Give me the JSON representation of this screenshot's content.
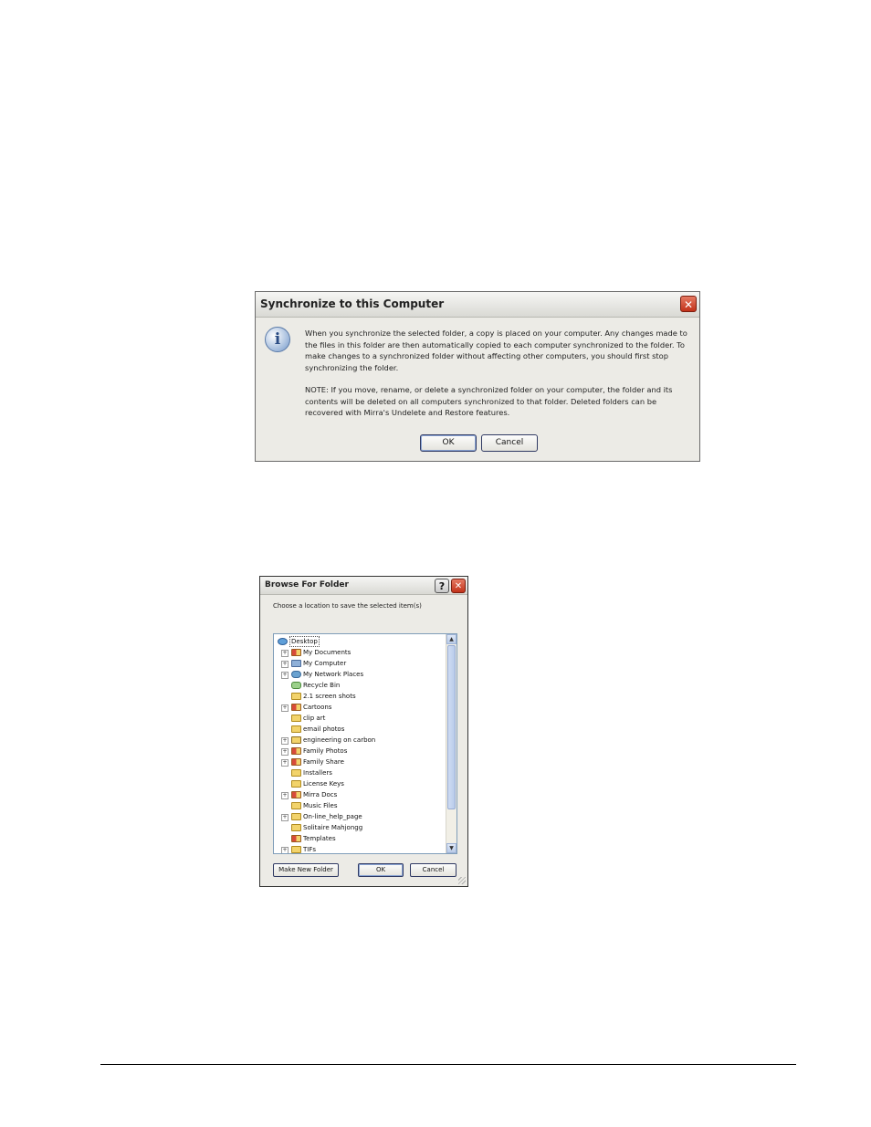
{
  "sync_dialog": {
    "title": "Synchronize to this Computer",
    "close_glyph": "✕",
    "info_icon_glyph": "i",
    "message_1": "When you synchronize the selected folder, a copy is placed on your computer. Any changes made to the files in this folder are then automatically copied to each computer synchronized to the folder.  To make changes to a synchronized folder without affecting other computers, you should first stop synchronizing the folder.",
    "message_2": "NOTE: If you move, rename, or delete a synchronized folder on your computer, the folder and its contents will be deleted on all computers synchronized to that folder.  Deleted folders can be recovered with Mirra's Undelete and Restore features.",
    "ok_label": "OK",
    "cancel_label": "Cancel"
  },
  "browse_dialog": {
    "title": "Browse For Folder",
    "help_glyph": "?",
    "close_glyph": "✕",
    "prompt": "Choose a location to save the selected item(s)",
    "tree": [
      {
        "label": "Desktop",
        "icon": "desktop-icon",
        "level": 0,
        "expander": "",
        "selected": true
      },
      {
        "label": "My Documents",
        "icon": "special-folder-icon",
        "level": 1,
        "expander": "+"
      },
      {
        "label": "My Computer",
        "icon": "computer-icon",
        "level": 1,
        "expander": "+"
      },
      {
        "label": "My Network Places",
        "icon": "network-icon",
        "level": 1,
        "expander": "+"
      },
      {
        "label": "Recycle Bin",
        "icon": "recycle-bin-icon",
        "level": 1,
        "expander": ""
      },
      {
        "label": "2.1 screen shots",
        "icon": "folder-icon",
        "level": 1,
        "expander": ""
      },
      {
        "label": "Cartoons",
        "icon": "special-folder-icon",
        "level": 1,
        "expander": "+"
      },
      {
        "label": "clip art",
        "icon": "folder-icon",
        "level": 1,
        "expander": ""
      },
      {
        "label": "email photos",
        "icon": "folder-icon",
        "level": 1,
        "expander": ""
      },
      {
        "label": "engineering on carbon",
        "icon": "document-icon",
        "level": 1,
        "expander": "+"
      },
      {
        "label": "Family Photos",
        "icon": "special-folder-icon",
        "level": 1,
        "expander": "+"
      },
      {
        "label": "Family Share",
        "icon": "special-folder-icon",
        "level": 1,
        "expander": "+"
      },
      {
        "label": "Installers",
        "icon": "folder-icon",
        "level": 1,
        "expander": ""
      },
      {
        "label": "License Keys",
        "icon": "folder-icon",
        "level": 1,
        "expander": ""
      },
      {
        "label": "Mirra Docs",
        "icon": "special-folder-icon",
        "level": 1,
        "expander": "+"
      },
      {
        "label": "Music Files",
        "icon": "folder-icon",
        "level": 1,
        "expander": ""
      },
      {
        "label": "On-line_help_page",
        "icon": "folder-icon",
        "level": 1,
        "expander": "+"
      },
      {
        "label": "Solitaire Mahjongg",
        "icon": "folder-icon",
        "level": 1,
        "expander": ""
      },
      {
        "label": "Templates",
        "icon": "special-folder-icon",
        "level": 1,
        "expander": ""
      },
      {
        "label": "TIFs",
        "icon": "folder-icon",
        "level": 1,
        "expander": "+"
      }
    ],
    "scroll_up_glyph": "▲",
    "scroll_down_glyph": "▼",
    "new_folder_label": "Make New Folder",
    "ok_label": "OK",
    "cancel_label": "Cancel"
  }
}
